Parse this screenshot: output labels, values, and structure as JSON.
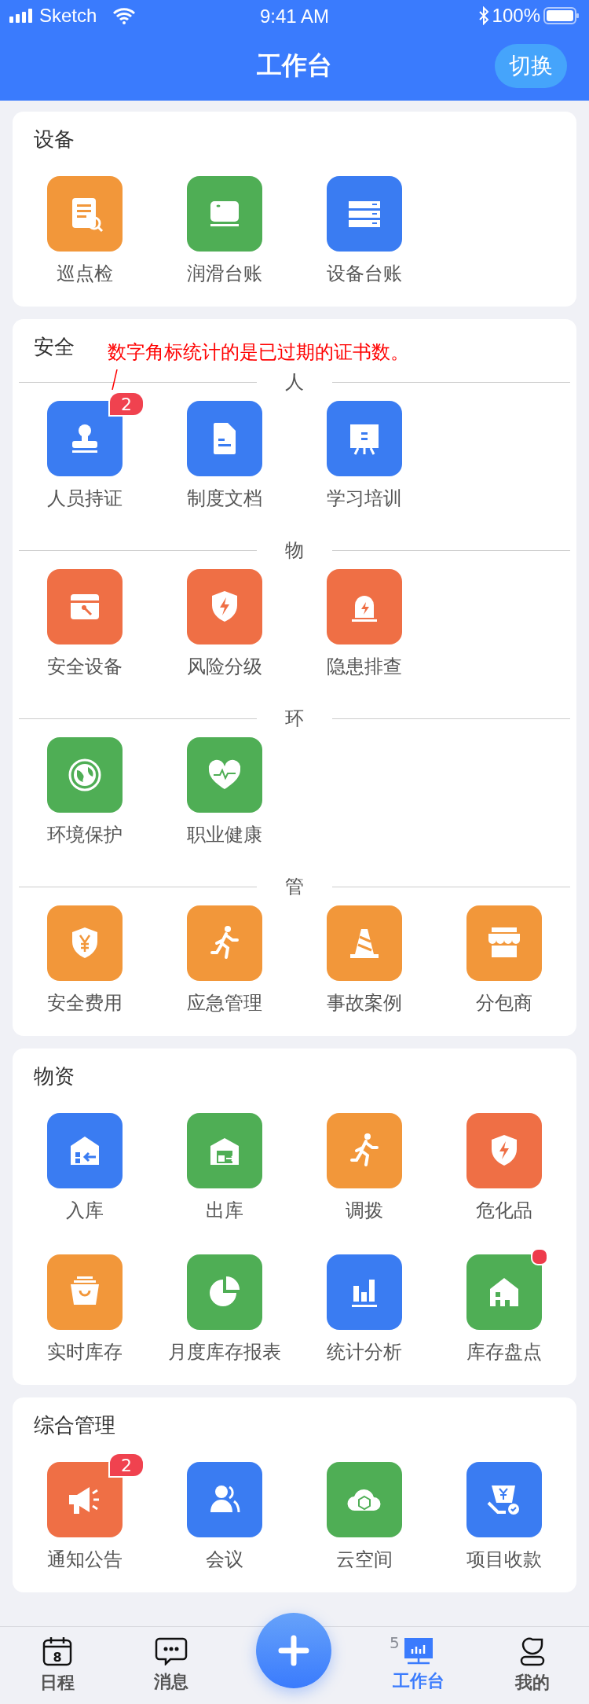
{
  "status_bar": {
    "carrier": "Sketch",
    "time": "9:41 AM",
    "battery": "100%"
  },
  "header": {
    "title": "工作台",
    "switch_button": "切换"
  },
  "sections": [
    {
      "title": "设备",
      "groups": [
        {
          "items": [
            {
              "label": "巡点检",
              "color": "#f2973a",
              "dot": false
            },
            {
              "label": "润滑台账",
              "color": "#4fae55",
              "dot": false
            },
            {
              "label": "设备台账",
              "color": "#3a7cf2",
              "dot": false
            }
          ]
        }
      ]
    },
    {
      "title": "安全",
      "annotation": "数字角标统计的是已过期的证书数。",
      "groups": [
        {
          "label": "人",
          "items": [
            {
              "label": "人员持证",
              "color": "#3a7cf2",
              "badge": "2",
              "dot": false
            },
            {
              "label": "制度文档",
              "color": "#3a7cf2",
              "dot": false
            },
            {
              "label": "学习培训",
              "color": "#3a7cf2",
              "dot": false
            }
          ]
        },
        {
          "label": "物",
          "items": [
            {
              "label": "安全设备",
              "color": "#ef6f45",
              "dot": false
            },
            {
              "label": "风险分级",
              "color": "#ef6f45",
              "dot": false
            },
            {
              "label": "隐患排查",
              "color": "#ef6f45",
              "dot": false
            }
          ]
        },
        {
          "label": "环",
          "items": [
            {
              "label": "环境保护",
              "color": "#4fae55",
              "dot": false
            },
            {
              "label": "职业健康",
              "color": "#4fae55",
              "dot": false
            }
          ]
        },
        {
          "label": "管",
          "items": [
            {
              "label": "安全费用",
              "color": "#f2973a",
              "dot": false
            },
            {
              "label": "应急管理",
              "color": "#f2973a",
              "dot": false
            },
            {
              "label": "事故案例",
              "color": "#f2973a",
              "dot": false
            },
            {
              "label": "分包商",
              "color": "#f2973a",
              "dot": false
            }
          ]
        }
      ]
    },
    {
      "title": "物资",
      "groups": [
        {
          "items": [
            {
              "label": "入库",
              "color": "#3a7cf2",
              "dot": false
            },
            {
              "label": "出库",
              "color": "#4fae55",
              "dot": false
            },
            {
              "label": "调拨",
              "color": "#f2973a",
              "dot": false
            },
            {
              "label": "危化品",
              "color": "#ef6f45",
              "dot": false
            },
            {
              "label": "实时库存",
              "color": "#f2973a",
              "dot": false
            },
            {
              "label": "月度库存报表",
              "color": "#4fae55",
              "dot": false
            },
            {
              "label": "统计分析",
              "color": "#3a7cf2",
              "dot": false
            },
            {
              "label": "库存盘点",
              "color": "#4fae55",
              "dot": true
            }
          ]
        }
      ]
    },
    {
      "title": "综合管理",
      "groups": [
        {
          "items": [
            {
              "label": "通知公告",
              "color": "#ef6f45",
              "badge": "2",
              "dot": false
            },
            {
              "label": "会议",
              "color": "#3a7cf2",
              "dot": false
            },
            {
              "label": "云空间",
              "color": "#4fae55",
              "dot": false
            },
            {
              "label": "项目收款",
              "color": "#3a7cf2",
              "dot": false
            }
          ]
        }
      ]
    }
  ],
  "tab_bar": {
    "tabs": [
      {
        "label": "日程",
        "selected": false,
        "calendar_day": "8"
      },
      {
        "label": "消息",
        "selected": false
      },
      {
        "label": "工作台",
        "selected": true,
        "counter": "5"
      },
      {
        "label": "我的",
        "selected": false
      }
    ]
  }
}
